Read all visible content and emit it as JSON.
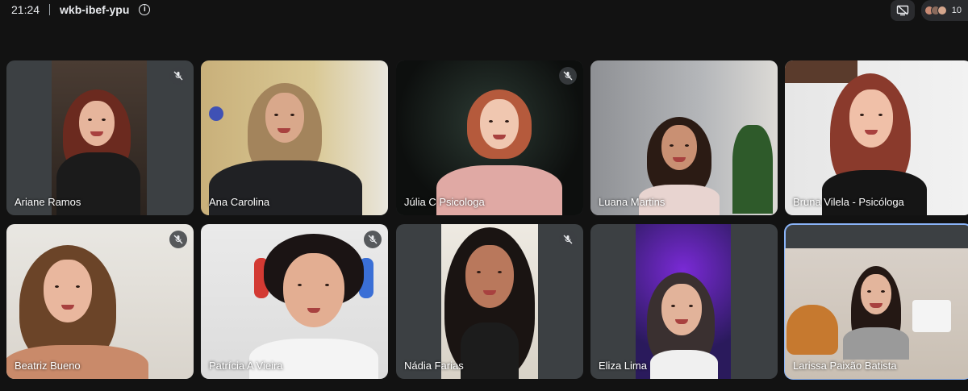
{
  "header": {
    "time": "21:24",
    "meeting_code": "wkb-ibef-ypu",
    "info_icon": "info-icon",
    "presentation_icon": "present-off-icon",
    "participants_count": "10"
  },
  "colors": {
    "background": "#121212",
    "tile_background": "#3c4043",
    "active_speaker_border": "#8ab4f8"
  },
  "participants": [
    {
      "name": "Ariane Ramos",
      "muted": true
    },
    {
      "name": "Ana Carolina",
      "muted": false
    },
    {
      "name": "Júlia C Psicologa",
      "muted": true
    },
    {
      "name": "Luana Martins",
      "muted": false
    },
    {
      "name": "Bruna Vilela - Psicóloga",
      "muted": false
    },
    {
      "name": "Beatriz Bueno",
      "muted": true
    },
    {
      "name": "Patrícia A Vieira",
      "muted": true
    },
    {
      "name": "Nádia Farias",
      "muted": true
    },
    {
      "name": "Eliza Lima",
      "muted": false
    },
    {
      "name": "Larissa Paixão Batista",
      "muted": false,
      "active_speaker": true
    }
  ]
}
